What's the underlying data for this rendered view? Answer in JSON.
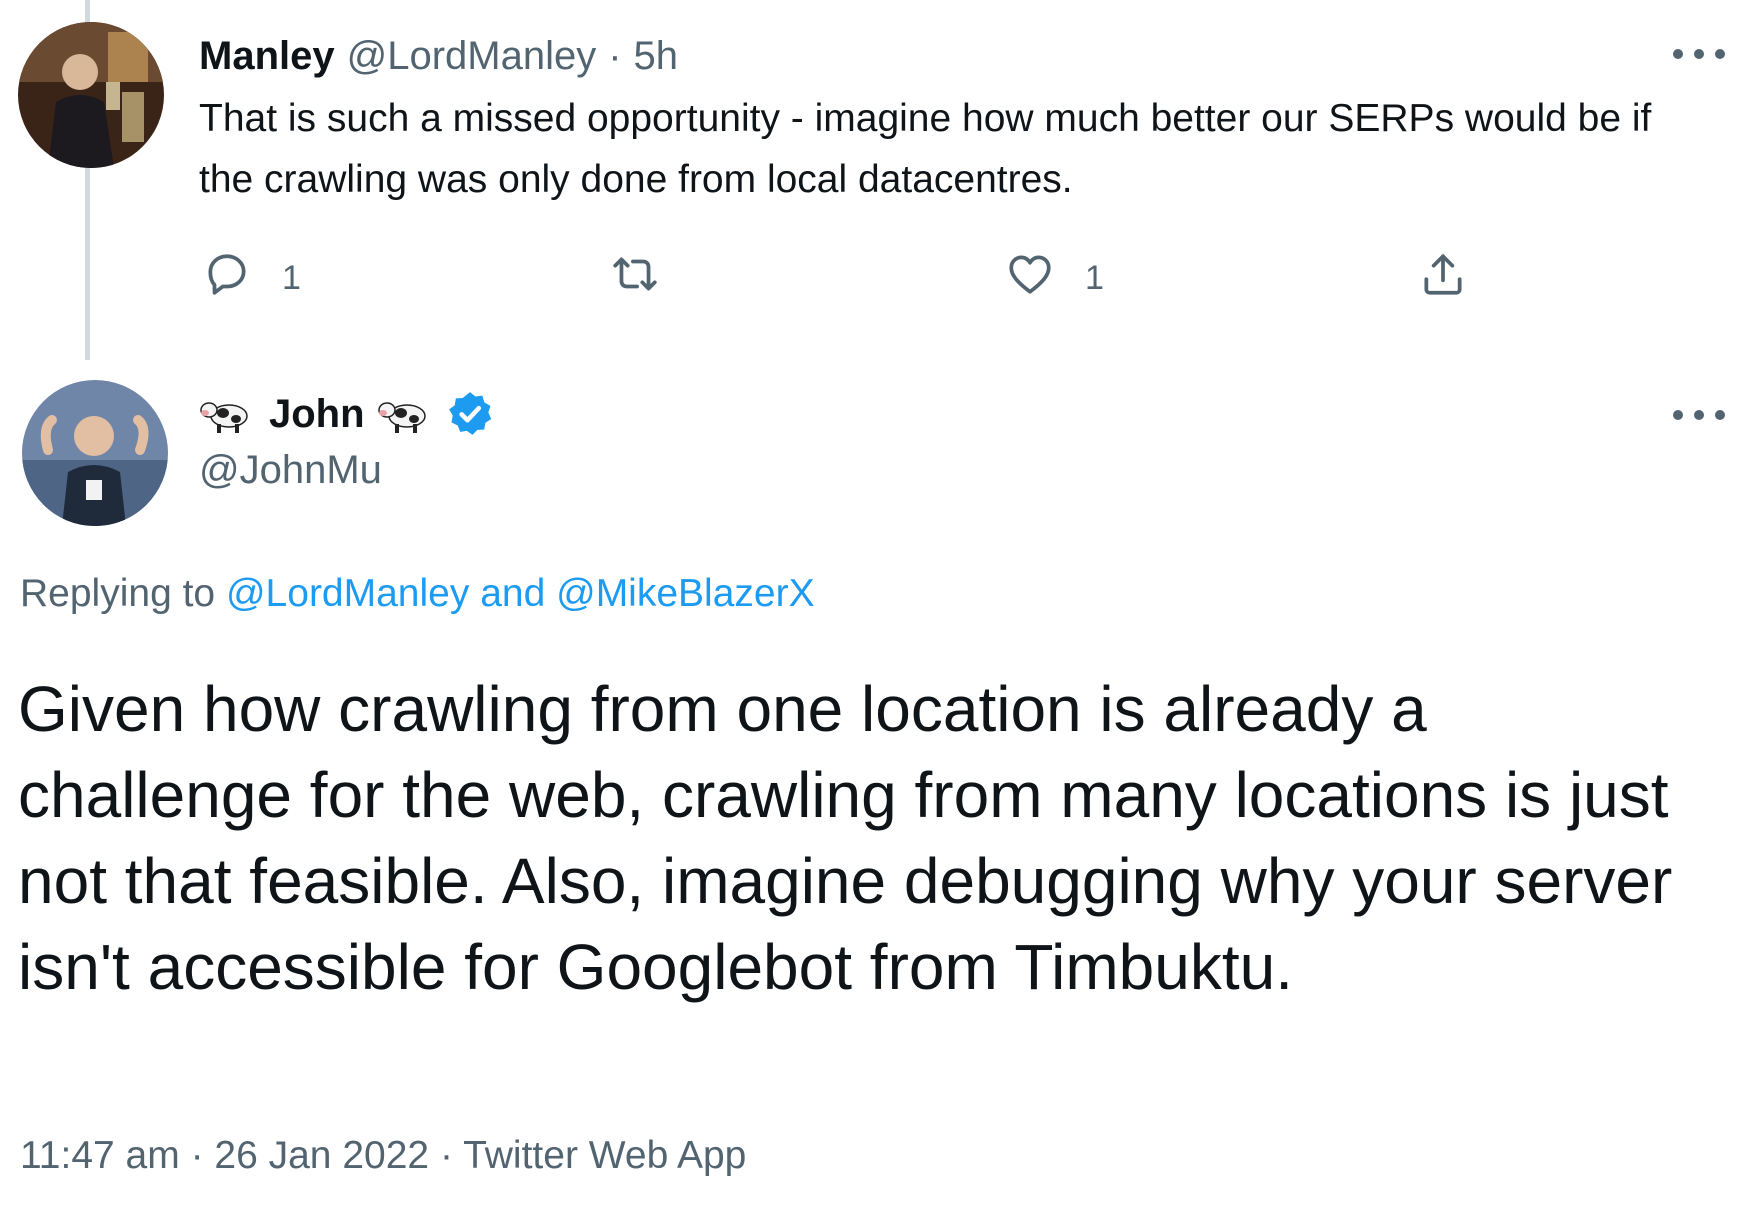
{
  "tweet1": {
    "display_name": "Manley",
    "handle": "@LordManley",
    "separator": "·",
    "time": "5h",
    "text": "That is such a missed opportunity - imagine how much better our SERPs would be if the crawling was only done from local datacentres.",
    "actions": {
      "reply_count": "1",
      "retweet_count": "",
      "like_count": "1"
    },
    "icons": [
      "reply-icon",
      "retweet-icon",
      "like-icon",
      "share-icon",
      "more-icon"
    ]
  },
  "tweet2": {
    "display_name": "John",
    "name_emoji": "cow-icon",
    "verified": true,
    "handle": "@JohnMu",
    "replying_prefix": "Replying to",
    "replying_users": [
      "@LordManley",
      "@MikeBlazerX"
    ],
    "replying_conjunction": "and",
    "text": "Given how crawling from one location is already a challenge for the web, crawling from many locations is just not that feasible. Also, imagine debugging why your server isn't accessible for Googlebot from Timbuktu.",
    "timestamp_time": "11:47 am",
    "timestamp_date": "26 Jan 2022",
    "separator": "·",
    "source": "Twitter Web App"
  },
  "colors": {
    "text": "#0f1419",
    "muted": "#536471",
    "link": "#1d9bf0",
    "thread_line": "#cfd9de"
  }
}
